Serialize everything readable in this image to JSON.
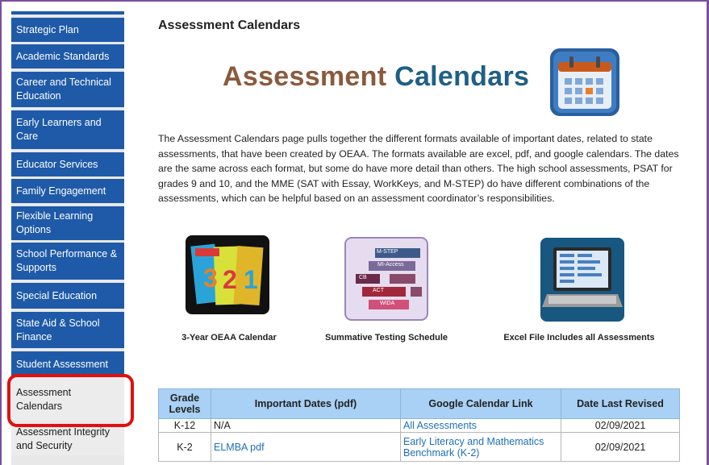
{
  "sidebar": {
    "items": [
      {
        "label": "Strategic Plan"
      },
      {
        "label": "Academic Standards"
      },
      {
        "label": "Career and Technical Education"
      },
      {
        "label": "Early Learners and Care"
      },
      {
        "label": "Educator Services"
      },
      {
        "label": "Family Engagement"
      },
      {
        "label": "Flexible Learning Options"
      },
      {
        "label": "School Performance & Supports"
      },
      {
        "label": "Special Education"
      },
      {
        "label": "State Aid & School Finance"
      },
      {
        "label": "Student Assessment"
      },
      {
        "label": "Assessment Calendars"
      },
      {
        "label": "Assessment Integrity and Security"
      }
    ]
  },
  "main": {
    "title": "Assessment Calendars",
    "banner": {
      "word1": "Assessment",
      "word2": "Calendars"
    },
    "intro": "The Assessment Calendars page pulls together the different formats available of important dates, related to state assessments, that have been created by OEAA. The formats available are excel, pdf, and google calendars. The dates are the same across each format, but some do have more detail than others. The high school assessments, PSAT for grades 9 and 10, and the MME (SAT with Essay, WorkKeys, and M-STEP) do have different combinations of the assessments, which can be helpful based on an assessment coordinator’s responsibilities.",
    "cards": [
      {
        "caption": "3-Year OEAA Calendar",
        "icon": "calendar-numbers-icon"
      },
      {
        "caption": "Summative Testing Schedule",
        "icon": "testing-schedule-icon"
      },
      {
        "caption": "Excel File Includes all Assessments",
        "icon": "laptop-spreadsheet-icon"
      }
    ],
    "schedule_labels": [
      "M-STEP",
      "MI-Access",
      "CB",
      "ACT",
      "WIDA"
    ]
  },
  "table": {
    "headers": [
      "Grade Levels",
      "Important Dates (pdf)",
      "Google Calendar Link",
      "Date Last Revised"
    ],
    "rows": [
      {
        "grade": "K-12",
        "pdf": "N/A",
        "gcal": "All Assessments",
        "revised": "02/09/2021"
      },
      {
        "grade": "K-2",
        "pdf": "ELMBA pdf",
        "gcal": "Early Literacy and Mathematics Benchmark (K-2)",
        "revised": "02/09/2021"
      }
    ]
  },
  "colors": {
    "sidebar_blue": "#1e5aa8",
    "highlight_red": "#e01010",
    "link_blue": "#1f6fb8",
    "table_header": "#a9d0f5",
    "frame_purple": "#7a4fa0"
  }
}
